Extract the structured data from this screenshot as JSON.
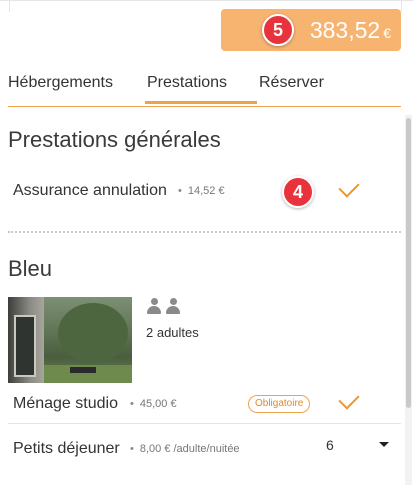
{
  "header": {
    "total_price": "383,52",
    "currency": "€",
    "step_badge_top": "5",
    "step_badge_insurance": "4"
  },
  "tabs": [
    {
      "label": "Hébergements",
      "active": false
    },
    {
      "label": "Prestations",
      "active": true
    },
    {
      "label": "Réserver",
      "active": false
    }
  ],
  "general": {
    "title": "Prestations générales",
    "items": [
      {
        "label": "Assurance annulation",
        "price": "14,52 €",
        "checked": true
      }
    ]
  },
  "room": {
    "title": "Bleu",
    "guests": "2 adultes",
    "items": [
      {
        "label": "Ménage studio",
        "price": "45,00 €",
        "tag": "Obligatoire",
        "checked": true
      },
      {
        "label": "Petits déjeuner",
        "price": "8,00 € /adulte/nuitée",
        "quantity": "6"
      }
    ]
  },
  "colors": {
    "accent": "#f0a24b",
    "price_badge": "#f7b471",
    "step_badge": "#e8333c"
  }
}
